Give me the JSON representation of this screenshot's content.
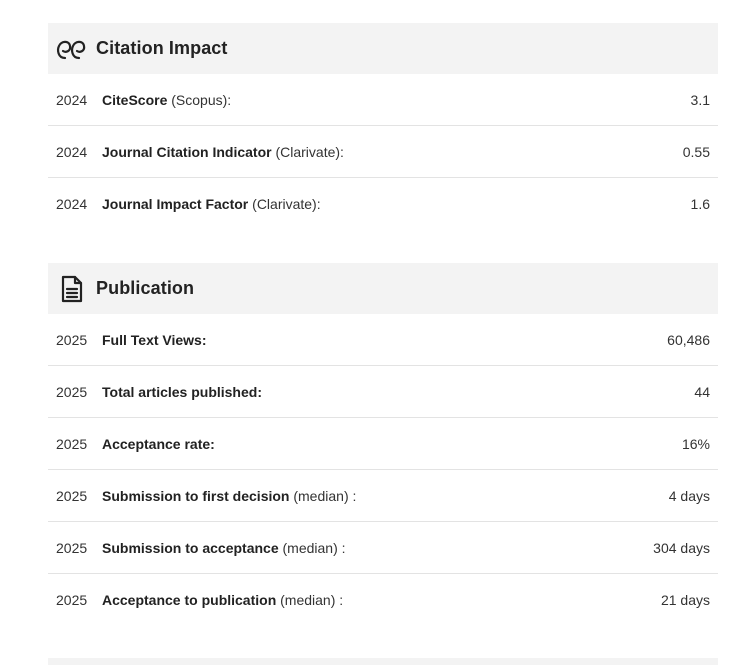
{
  "citation": {
    "title": "Citation Impact",
    "icon": "quote-icon",
    "rows": [
      {
        "year": "2024",
        "label": "CiteScore",
        "suffix": " (Scopus):",
        "value": "3.1"
      },
      {
        "year": "2024",
        "label": "Journal Citation Indicator",
        "suffix": " (Clarivate):",
        "value": "0.55"
      },
      {
        "year": "2024",
        "label": "Journal Impact Factor",
        "suffix": " (Clarivate):",
        "value": "1.6"
      }
    ]
  },
  "publication": {
    "title": "Publication",
    "icon": "document-icon",
    "rows": [
      {
        "year": "2025",
        "label": "Full Text Views:",
        "suffix": "",
        "value": "60,486"
      },
      {
        "year": "2025",
        "label": "Total articles published:",
        "suffix": "",
        "value": "44"
      },
      {
        "year": "2025",
        "label": "Acceptance rate:",
        "suffix": "",
        "value": "16%"
      },
      {
        "year": "2025",
        "label": "Submission to first decision",
        "suffix": " (median) :",
        "value": "4 days"
      },
      {
        "year": "2025",
        "label": "Submission to acceptance",
        "suffix": " (median) :",
        "value": "304 days"
      },
      {
        "year": "2025",
        "label": "Acceptance to publication",
        "suffix": " (median) :",
        "value": "21 days"
      }
    ]
  }
}
